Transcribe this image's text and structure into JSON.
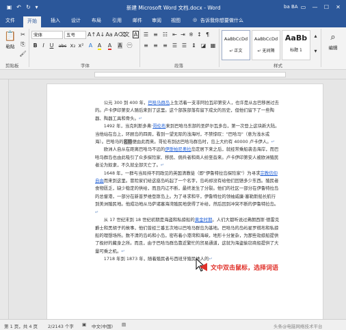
{
  "titlebar": {
    "title": "新建 Microsoft Word 文档.docx - Word",
    "user": "ba BA",
    "save_icon": "save-icon",
    "undo_icon": "undo-icon",
    "redo_icon": "redo-icon",
    "ribbon_options_icon": "ribbon-display-icon",
    "minimize": "—",
    "maximize": "☐",
    "close": "✕"
  },
  "menu": {
    "tabs": [
      "文件",
      "开始",
      "插入",
      "设计",
      "布局",
      "引用",
      "邮件",
      "审阅",
      "视图"
    ],
    "active_tab": "开始",
    "tell_me": "告诉我你想要做什么"
  },
  "ribbon": {
    "paste_label": "粘贴",
    "clipboard_label": "剪贴板",
    "font_name": "宋体",
    "font_size": "五号",
    "font_label": "字体",
    "paragraph_label": "段落",
    "styles_label": "样式",
    "editing_label": "编辑",
    "styles": [
      {
        "preview": "AaBbCcDd",
        "name": "↵ 正文"
      },
      {
        "preview": "AaBbCcDd",
        "name": "↵ 无间隔"
      },
      {
        "preview": "AaBb",
        "name": "标题 1"
      }
    ],
    "bold": "B",
    "italic": "I",
    "underline": "U",
    "strike": "abc",
    "subscript": "x₂",
    "superscript": "x²",
    "font_color_letter": "A",
    "highlight_letter": "A",
    "char_shading": "A",
    "char_border": "A"
  },
  "document": {
    "paragraphs": [
      {
        "before": "公元 300 到 400 年，",
        "link": "巴哈马群岛",
        "after": "上生活着一支非阿拉瓦印第安人，也许是从古巴移居过去的。卢卡伊印第安人随后来到了这里。这个部族部落有留下成文的历史，但他们留下了一些陶器、陶器工具和骨头。"
      },
      {
        "before": "1492 年，当克利斯多弗·",
        "link": "哥伦布",
        "after": "来到巴哈马东部的圣萨尔瓦多岛，第一次登上这块新大陆。当他站在岛上，环顾岛的四周，看到一望无际的浅海时，不禁惊叹：\"巴哈马\"（意为浅水或海）。巴哈马的名称便由此而来。哥伦布到达巴哈马群岛时，岛上大约有 40000 卢卡伊人。"
      },
      {
        "before": "欧洲人自从在距离巴哈马不远的",
        "link": "伊斯帕尼奥拉",
        "after": "岛定居下来之后，就经常乘船袭击海岸，而巴哈马群岛也由此吸引了众多探险家、移民、佣兵者和商人纷至沓来。卢卡伊印第安人被欧洲殖民者沦为奴隶，不久就全部灭亡了。"
      },
      {
        "before": "1648 年，一群与当局持不同政见的英国清教徒（即\"伊鲁特拉岛探险家\"）为寻求",
        "link": "宗教信仰自由",
        "after": "而来到这里。冒险家们给这座岛屿起了一个名字，岛屿却没有给他们回馈多少东西。殖民者食物匮乏，缺少稳定的供给，而且内讧不断，最终发生了分裂。他们的社区一部分在伊鲁特拉岛的总督港，一部分在新普罗维登斯岛上。为了寻求和平，伊鲁特拉的领袖威廉·塞勒斯船长航行到美洲殖民地。他成功地从马萨诸塞海湾殖民地获得了补给，然后回到冲突不断的伊鲁特拉岛。"
      },
      {
        "before": "从 17 世纪末到 18 世纪初期是海盗和私掠船的",
        "link": "黄金时期",
        "after": "。人们大都听说过弗朗西斯·德雷克爵士和黑胡子的故事，他们曾经三番五次地以巴哈马群岛为基地。巴哈马的岛屿星罗棋布和私掠船的理想场所。数不清的岛屿和小岛，密布着小港湾和海峡，地形十分复杂，为那些劫掠船提供了极好的藏身之所。而且，由于巴哈马群岛靠近繁忙的贸易通道，这就为海盗偷窃商船提供了大量可乘之机。"
      },
      {
        "before": "1718 年到 1873 年，随着殖民者与西班牙殖民地人的",
        "link": "",
        "after": ""
      }
    ],
    "selected_word": "名称"
  },
  "callout": {
    "text": "文中双击鼠标，选择词语"
  },
  "status": {
    "page": "第 1 页，共 4 页",
    "words": "2/2143 个字",
    "language": "中文(中国)",
    "zoom": "100%",
    "watermark": "头条@电脑网络技术平台"
  },
  "colors": {
    "accent": "#2b579a",
    "callout": "#e0312a",
    "link": "#1f5fd6"
  }
}
